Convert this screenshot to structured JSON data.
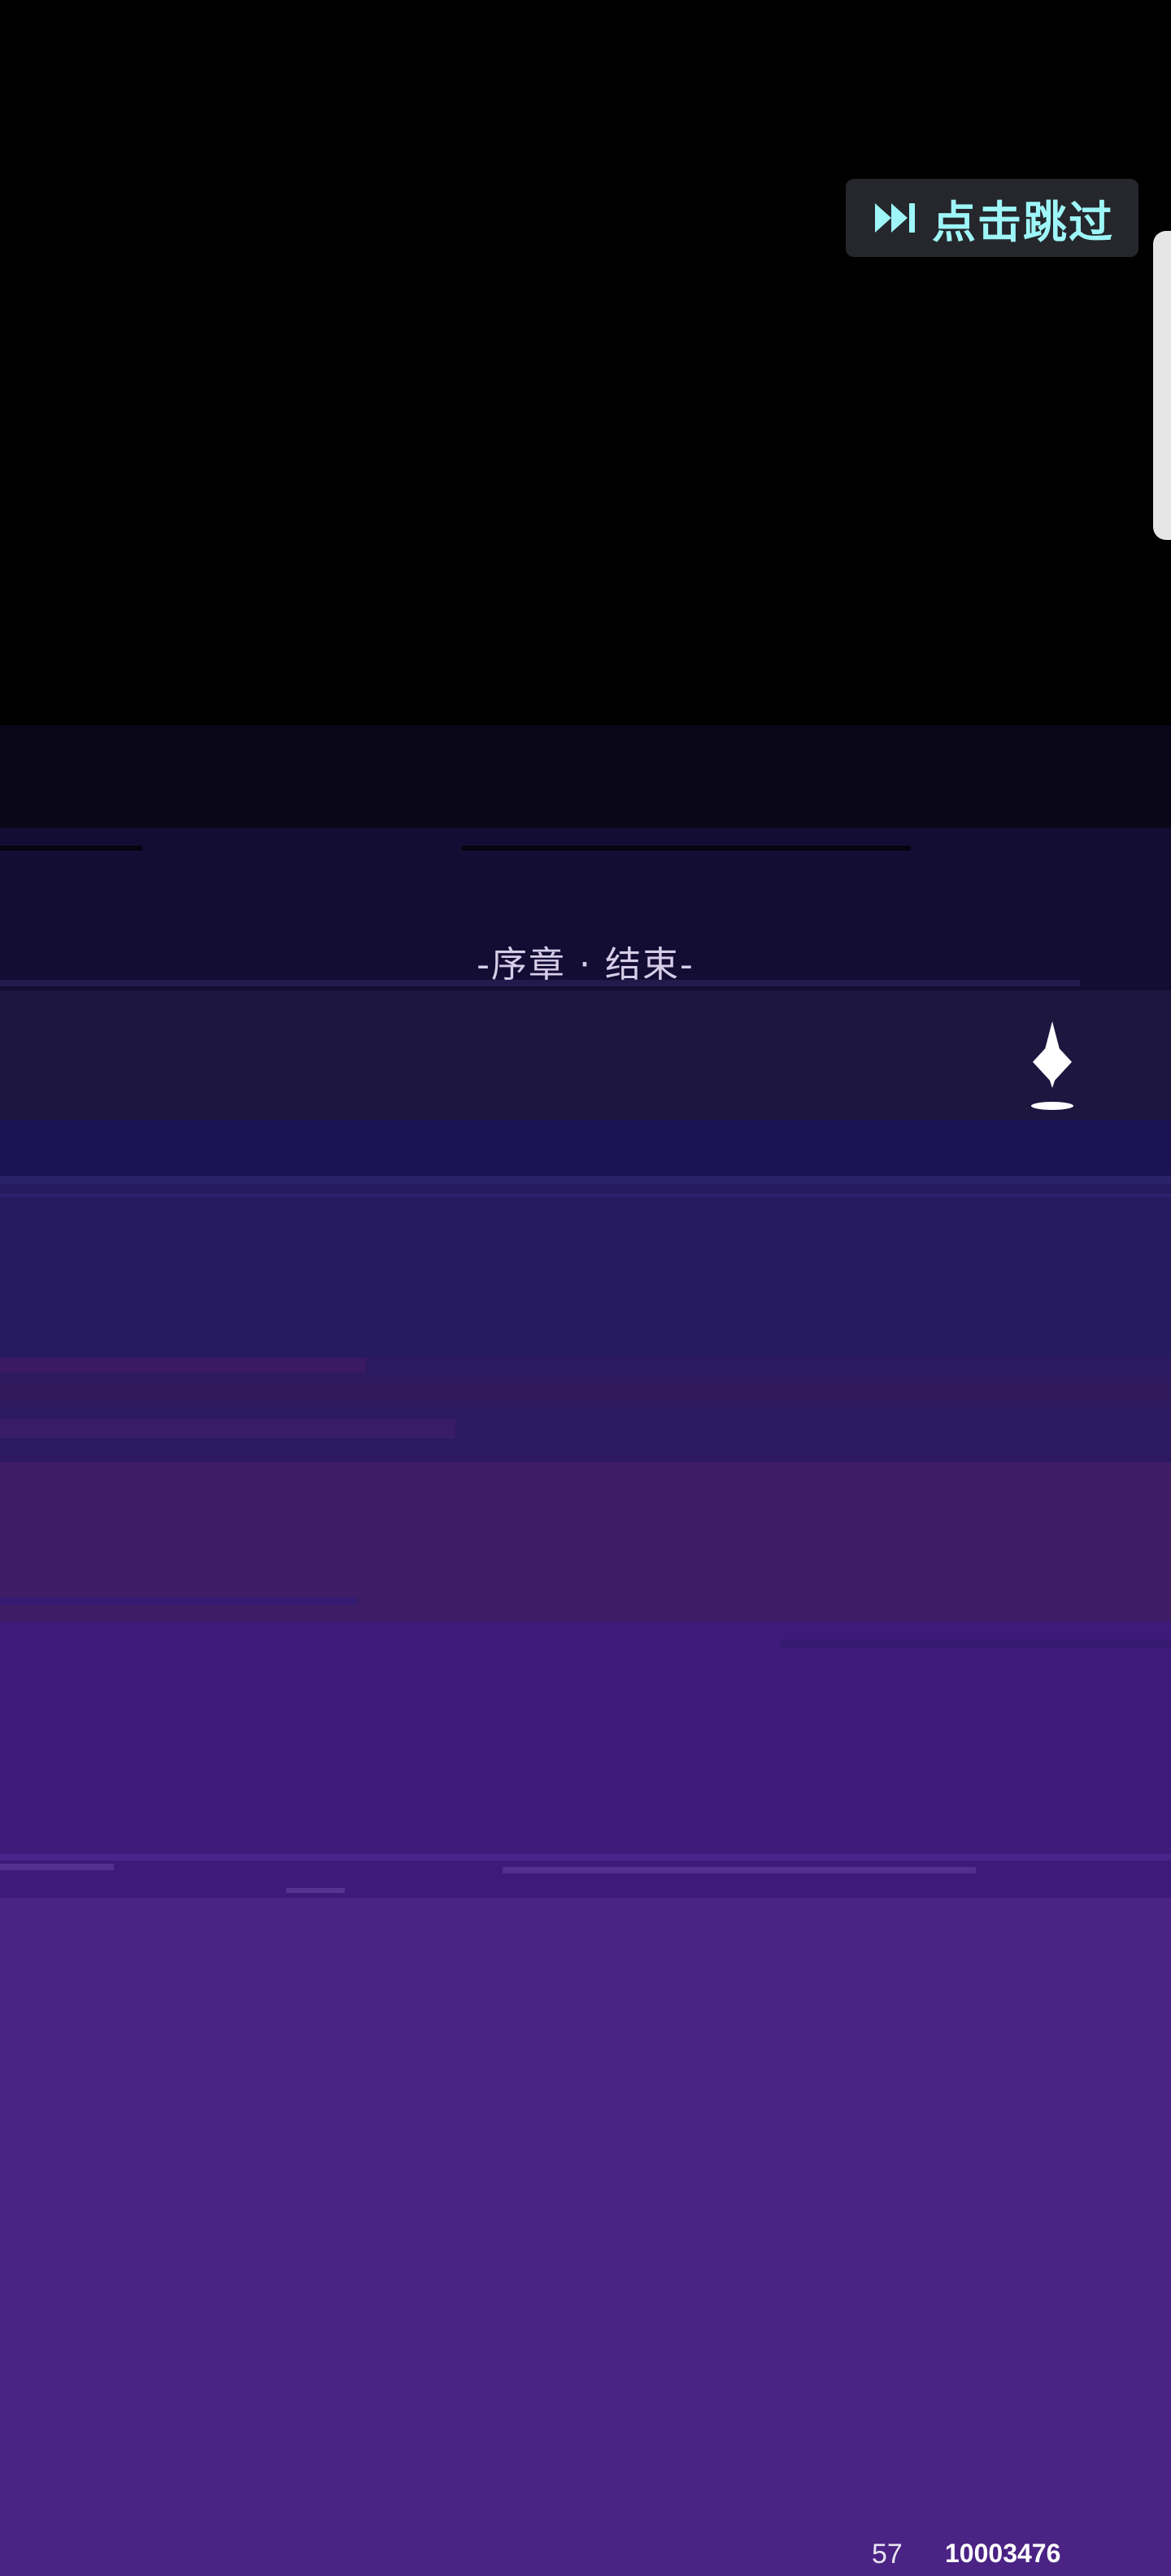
{
  "skip_button": {
    "label": "点击跳过",
    "icon": "fast-forward-icon"
  },
  "chapter": {
    "title": "-序章 · 结束-"
  },
  "cursor": {
    "icon": "diamond-cursor-icon"
  },
  "footer": {
    "left_number": "57",
    "right_number": "10003476"
  },
  "colors": {
    "top": "#000000",
    "bottom": "#4a2385",
    "skip_text": "#9ef6f8",
    "title_text": "#d6cde8"
  }
}
